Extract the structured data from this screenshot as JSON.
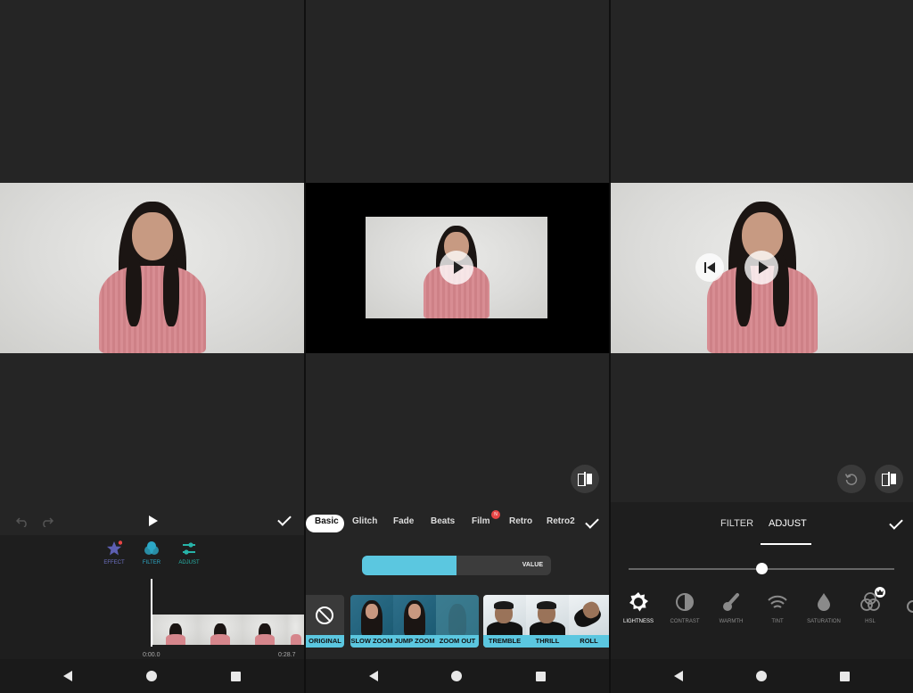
{
  "panel1": {
    "effect_label": "EFFECT",
    "filter_label": "FILTER",
    "adjust_label": "ADJUST",
    "time_start": "0:00.0",
    "time_end": "0:28.7"
  },
  "panel2": {
    "tabs": [
      "Basic",
      "Glitch",
      "Fade",
      "Beats",
      "Film",
      "Retro",
      "Retro2"
    ],
    "film_badge": "N",
    "value_label": "VALUE",
    "value_fraction": 0.5,
    "effects": [
      "ORIGINAL",
      "SLOW ZOOM",
      "JUMP ZOOM",
      "ZOOM OUT",
      "TREMBLE",
      "THRILL",
      "ROLL"
    ]
  },
  "panel3": {
    "tab_filter": "FILTER",
    "tab_adjust": "ADJUST",
    "slider_fraction": 0.5,
    "adjust_items": [
      "LIGHTNESS",
      "CONTRAST",
      "WARMTH",
      "TINT",
      "SATURATION",
      "HSL"
    ]
  },
  "colors": {
    "accent": "#5bc7e0",
    "effect_icon": "#5d5fb3",
    "filter_icon": "#2ca9c7",
    "adjust_icon": "#27b3a8",
    "badge": "#e64545"
  }
}
